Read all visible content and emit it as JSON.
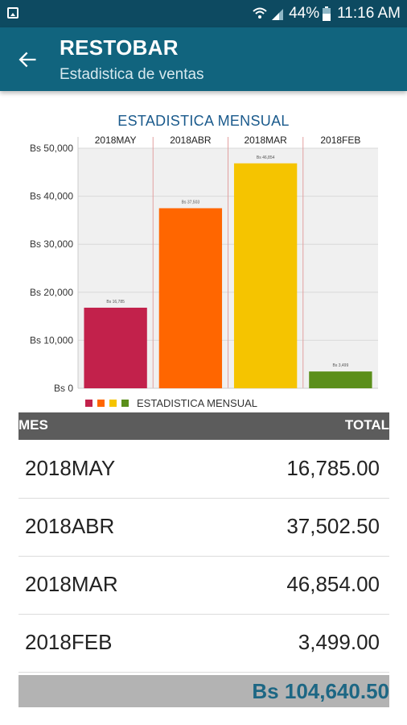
{
  "status_bar": {
    "battery": "44%",
    "time": "11:16 AM",
    "icons": [
      "image-icon",
      "wifi-icon",
      "signal-icon",
      "battery-icon"
    ]
  },
  "app_bar": {
    "title": "RESTOBAR",
    "subtitle": "Estadistica de ventas",
    "back_icon": "arrow-back-icon"
  },
  "chart_data": {
    "type": "bar",
    "title": "ESTADISTICA MENSUAL",
    "categories": [
      "2018MAY",
      "2018ABR",
      "2018MAR",
      "2018FEB"
    ],
    "values": [
      16785,
      37502.5,
      46854,
      3499
    ],
    "data_labels": [
      "Bs 16,785",
      "Bs 37,503",
      "Bs 46,854",
      "Bs 3,499"
    ],
    "colors": [
      "#c2214b",
      "#ff6600",
      "#f5c400",
      "#5b8f1b"
    ],
    "ylim": [
      0,
      50000
    ],
    "yticks": [
      0,
      10000,
      20000,
      30000,
      40000,
      50000
    ],
    "ytick_labels": [
      "Bs 0",
      "Bs 10,000",
      "Bs 20,000",
      "Bs 30,000",
      "Bs 40,000",
      "Bs 50,000"
    ],
    "grid": true,
    "legend": {
      "label": "ESTADISTICA MENSUAL",
      "placement": "bottom"
    },
    "category_axis_position": "top"
  },
  "table": {
    "headers": {
      "mes": "MES",
      "total": "TOTAL"
    },
    "rows": [
      {
        "mes": "2018MAY",
        "total": "16,785.00"
      },
      {
        "mes": "2018ABR",
        "total": "37,502.50"
      },
      {
        "mes": "2018MAR",
        "total": "46,854.00"
      },
      {
        "mes": "2018FEB",
        "total": "3,499.00"
      }
    ],
    "grand_total": "Bs 104,640.50"
  }
}
